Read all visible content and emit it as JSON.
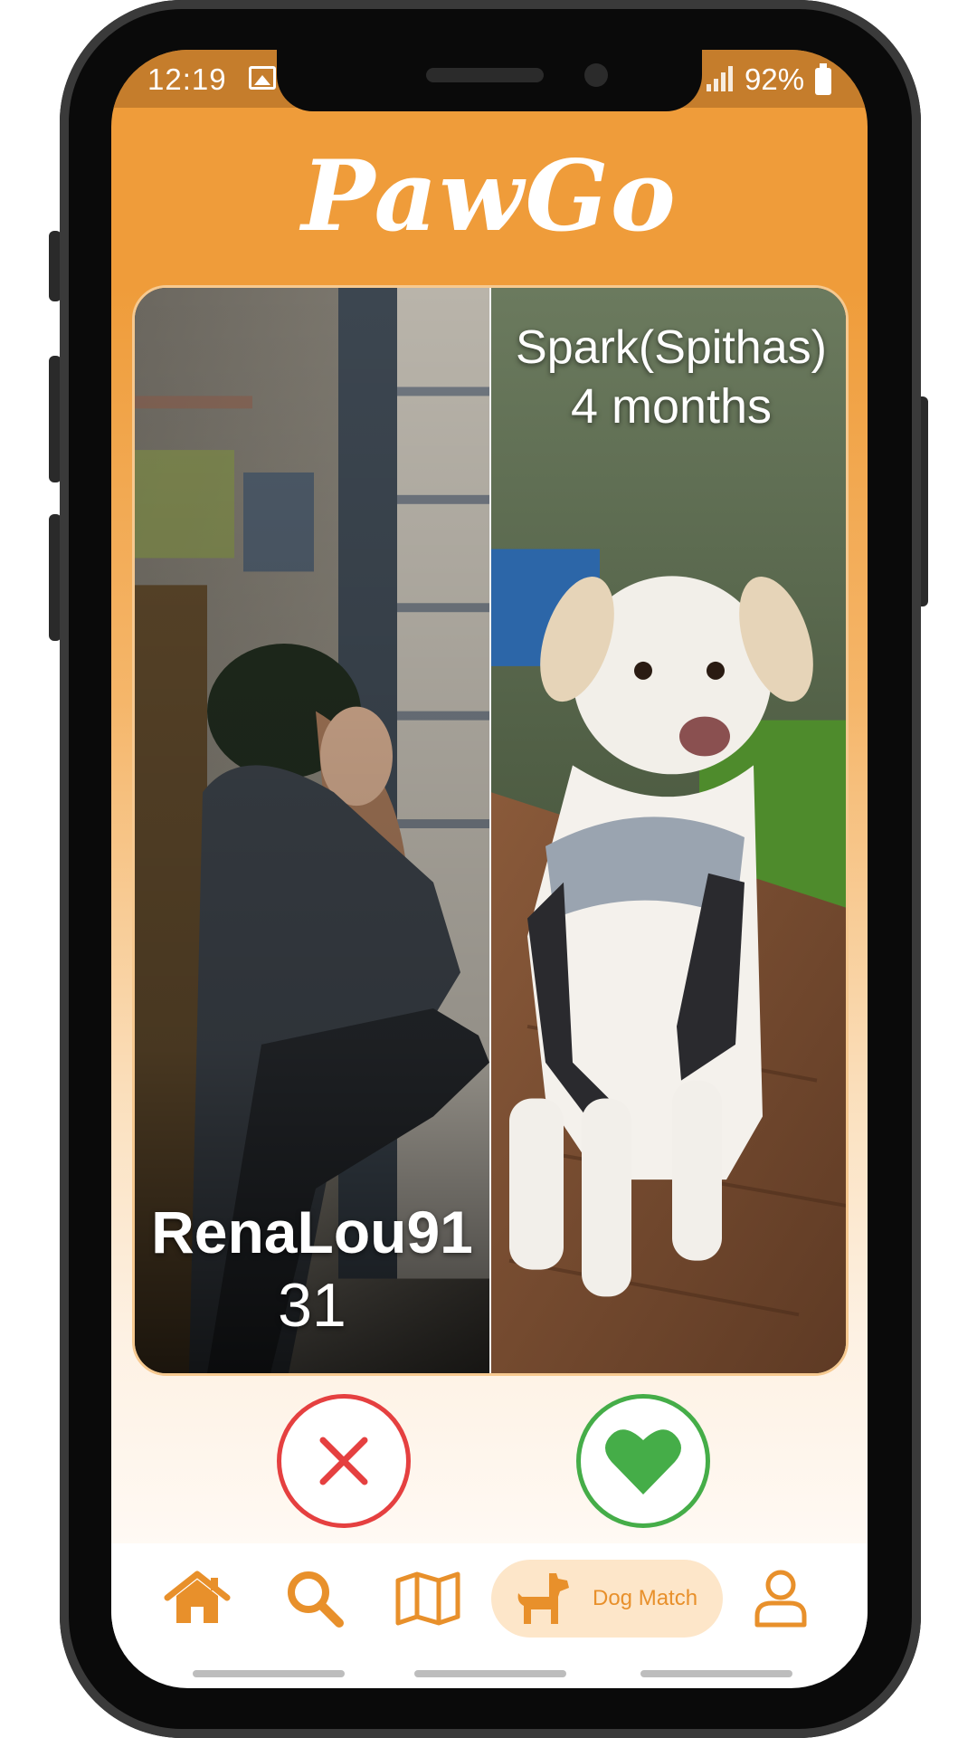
{
  "status_bar": {
    "time": "12:19",
    "battery": "92%"
  },
  "app": {
    "logo": "PawGo"
  },
  "match_card": {
    "owner": {
      "name": "RenaLou91",
      "age": "31"
    },
    "dog": {
      "name": "Spark(Spithas)",
      "age": "4 months"
    }
  },
  "actions": {
    "reject_icon": "close-icon",
    "like_icon": "heart-icon"
  },
  "bottom_nav": {
    "active": "Dog Match",
    "items": [
      {
        "icon": "home-icon"
      },
      {
        "icon": "search-icon"
      },
      {
        "icon": "map-icon"
      },
      {
        "icon": "dog-icon",
        "label": "Dog Match"
      },
      {
        "icon": "profile-icon"
      }
    ]
  },
  "colors": {
    "accent": "#ef9c3a",
    "reject": "#e54040",
    "like": "#45ad48",
    "active_tab_bg": "#fde6c9"
  }
}
